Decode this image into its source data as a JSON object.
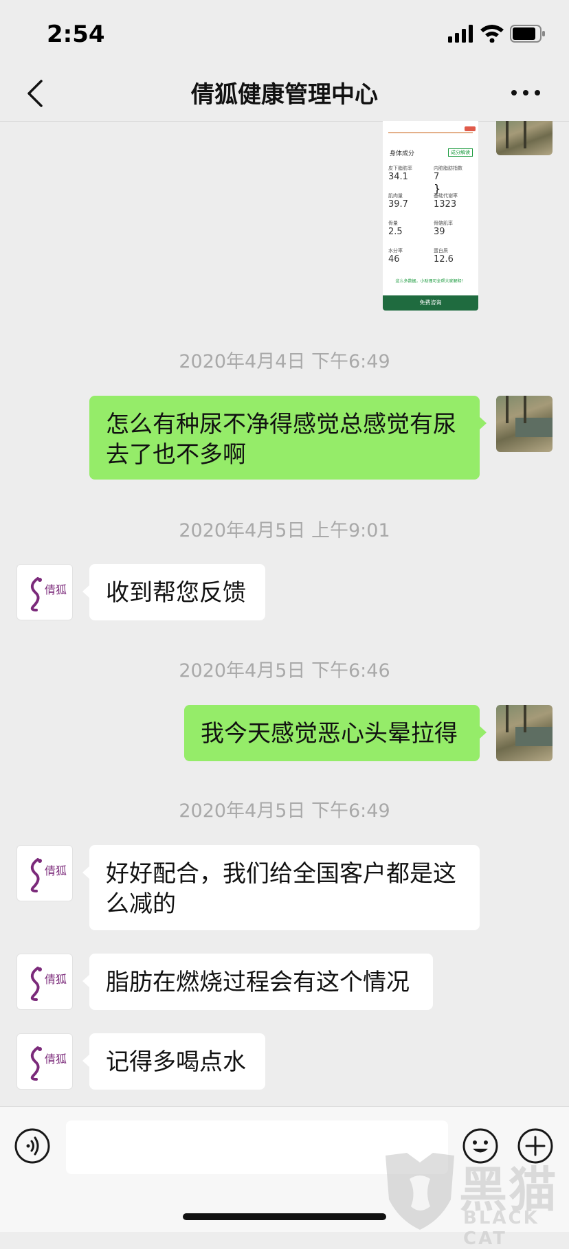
{
  "status_bar": {
    "time": "2:54"
  },
  "nav": {
    "title": "倩狐健康管理中心"
  },
  "image_message": {
    "section_title": "身体成分",
    "section_button": "成分解读",
    "metrics": [
      {
        "label": "皮下脂肪率",
        "value": "34.1"
      },
      {
        "label": "内脏脂肪指数",
        "value": "7"
      },
      {
        "label": "肌肉量",
        "value": "39.7"
      },
      {
        "label": "基础代谢率",
        "value": "1323"
      },
      {
        "label": "骨量",
        "value": "2.5"
      },
      {
        "label": "骨骼肌率",
        "value": "39"
      },
      {
        "label": "水分率",
        "value": "46"
      },
      {
        "label": "蛋白质",
        "value": "12.6"
      }
    ],
    "note": "这么多数据，小助理可全帮大家解释！",
    "cta": "免费咨询"
  },
  "messages": [
    {
      "type": "timestamp",
      "text": "2020年4月4日 下午6:49"
    },
    {
      "type": "me",
      "text": "怎么有种尿不净得感觉总感觉有尿去了也不多啊"
    },
    {
      "type": "timestamp",
      "text": "2020年4月5日 上午9:01"
    },
    {
      "type": "you",
      "text": "收到帮您反馈"
    },
    {
      "type": "timestamp",
      "text": "2020年4月5日 下午6:46"
    },
    {
      "type": "me",
      "text": "我今天感觉恶心头晕拉得"
    },
    {
      "type": "timestamp",
      "text": "2020年4月5日 下午6:49"
    },
    {
      "type": "you",
      "text": "好好配合，我们给全国客户都是这么减的"
    },
    {
      "type": "you",
      "text": "脂肪在燃烧过程会有这个情况"
    },
    {
      "type": "you",
      "text": "记得多喝点水"
    }
  ],
  "avatar_logo_text": "倩狐",
  "watermark": {
    "cn": "黑猫",
    "en": "BLACK CAT"
  },
  "colors": {
    "my_bubble": "#95ec69",
    "their_bubble": "#ffffff",
    "background": "#ededed"
  },
  "icons": [
    "back-chevron-icon",
    "more-dots-icon",
    "voice-icon",
    "emoji-icon",
    "plus-icon"
  ]
}
